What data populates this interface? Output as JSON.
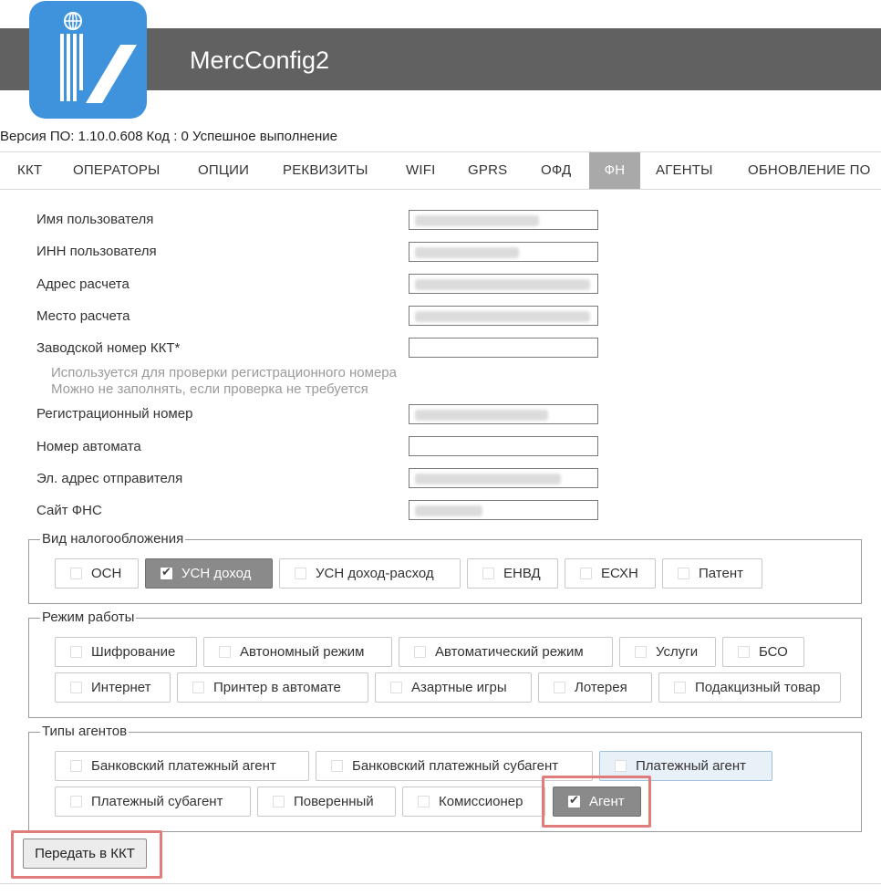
{
  "app": {
    "title": "MercConfig2"
  },
  "status": {
    "version_label": "Версия ПО: 1.10.0.608",
    "code_text": "Код : 0 Успешное выполнение"
  },
  "tabs": [
    "ККТ",
    "ОПЕРАТОРЫ",
    "ОПЦИИ",
    "РЕКВИЗИТЫ",
    "WIFI",
    "GPRS",
    "ОФД",
    "ФН",
    "АГЕНТЫ",
    "ОБНОВЛЕНИЕ ПО"
  ],
  "active_tab": "ФН",
  "form": {
    "user_name": {
      "label": "Имя пользователя",
      "value": ""
    },
    "user_inn": {
      "label": "ИНН пользователя",
      "value": ""
    },
    "calc_address": {
      "label": "Адрес расчета",
      "value": ""
    },
    "calc_place": {
      "label": "Место расчета",
      "value": ""
    },
    "factory_number": {
      "label": "Заводской номер ККТ*",
      "value": ""
    },
    "factory_hint_1": "Используется для проверки регистрационного номера",
    "factory_hint_2": "Можно не заполнять, если проверка не требуется",
    "reg_number": {
      "label": "Регистрационный номер",
      "value": ""
    },
    "machine_number": {
      "label": "Номер автомата",
      "value": ""
    },
    "sender_email": {
      "label": "Эл. адрес отправителя",
      "value": ""
    },
    "fns_site": {
      "label": "Сайт ФНС",
      "value": ""
    }
  },
  "taxation": {
    "legend": "Вид налогообложения",
    "options": [
      {
        "label": "ОСН",
        "checked": false
      },
      {
        "label": "УСН доход",
        "checked": true
      },
      {
        "label": "УСН доход-расход",
        "checked": false
      },
      {
        "label": "ЕНВД",
        "checked": false
      },
      {
        "label": "ЕСХН",
        "checked": false
      },
      {
        "label": "Патент",
        "checked": false
      }
    ]
  },
  "work_mode": {
    "legend": "Режим работы",
    "options": [
      {
        "label": "Шифрование",
        "checked": false
      },
      {
        "label": "Автономный режим",
        "checked": false
      },
      {
        "label": "Автоматический режим",
        "checked": false
      },
      {
        "label": "Услуги",
        "checked": false
      },
      {
        "label": "БСО",
        "checked": false
      },
      {
        "label": "Интернет",
        "checked": false
      },
      {
        "label": "Принтер в автомате",
        "checked": false
      },
      {
        "label": "Азартные игры",
        "checked": false
      },
      {
        "label": "Лотерея",
        "checked": false
      },
      {
        "label": "Подакцизный товар",
        "checked": false
      }
    ]
  },
  "agent_types": {
    "legend": "Типы агентов",
    "options": [
      {
        "label": "Банковский платежный агент",
        "checked": false
      },
      {
        "label": "Банковский платежный субагент",
        "checked": false
      },
      {
        "label": "Платежный агент",
        "checked": false
      },
      {
        "label": "Платежный субагент",
        "checked": false
      },
      {
        "label": "Поверенный",
        "checked": false
      },
      {
        "label": "Комиссионер",
        "checked": false
      },
      {
        "label": "Агент",
        "checked": true
      }
    ]
  },
  "actions": {
    "send_label": "Передать в ККТ"
  },
  "colors": {
    "header": "#616161",
    "logo": "#3f93dc",
    "active_tab": "#a9a9a9",
    "checked": "#8a8a8a",
    "highlight": "#e07c7c"
  }
}
